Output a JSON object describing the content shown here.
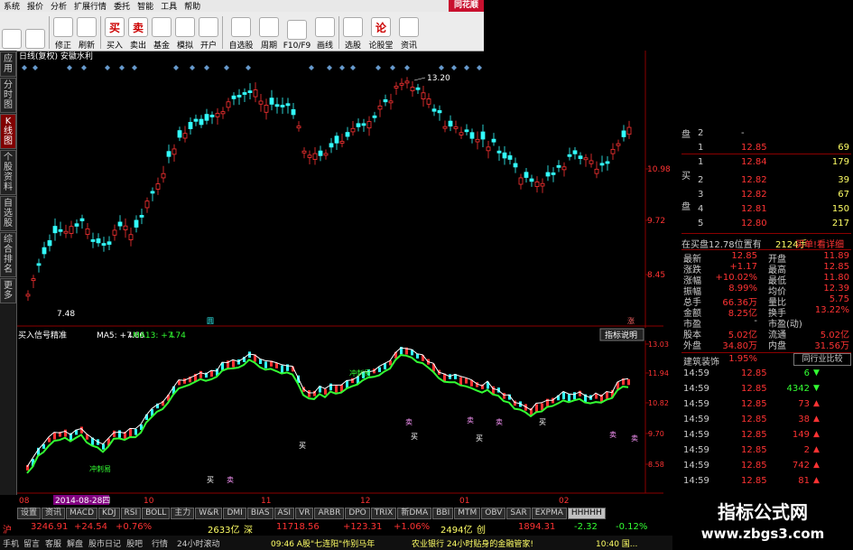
{
  "menu": [
    "系统",
    "报价",
    "分析",
    "扩展行情",
    "委托",
    "智能",
    "工具",
    "帮助"
  ],
  "brand": "同花顺",
  "toolbar": [
    {
      "label": "",
      "icon": "grid-icon"
    },
    {
      "label": "",
      "icon": "back-arrow-icon"
    },
    {
      "label": "修正",
      "icon": "fix-icon"
    },
    {
      "label": "刷新",
      "icon": "clock-icon"
    },
    {
      "label": "买入",
      "icon": "buy-icon",
      "glyph": "买"
    },
    {
      "label": "卖出",
      "icon": "sell-icon",
      "glyph": "卖"
    },
    {
      "label": "基金",
      "icon": "fund-icon"
    },
    {
      "label": "模拟",
      "icon": "hammer-icon"
    },
    {
      "label": "开户",
      "icon": "account-icon"
    },
    {
      "label": "自选股",
      "icon": "watchlist-icon"
    },
    {
      "label": "周期",
      "icon": "period-icon"
    },
    {
      "label": "F10/F9",
      "icon": "f10-icon"
    },
    {
      "label": "画线",
      "icon": "pen-icon"
    },
    {
      "label": "选股",
      "icon": "select-icon"
    },
    {
      "label": "论股堂",
      "icon": "forum-icon",
      "glyph": "论"
    },
    {
      "label": "资讯",
      "icon": "news-icon"
    }
  ],
  "left_tabs": [
    {
      "label": "应用"
    },
    {
      "label": "分时图"
    },
    {
      "label": "K线图",
      "active": true
    },
    {
      "label": "个股资料"
    },
    {
      "label": "自选股"
    },
    {
      "label": "综合排名"
    },
    {
      "label": "更多"
    }
  ],
  "chart_header": "日线(复权) 安徽水利",
  "price_labels": [
    "10.98",
    "9.72",
    "8.45"
  ],
  "annot_high": "13.20",
  "annot_low": "7.48",
  "indicator_bar": {
    "name": "买入信号精准",
    "ma5": "MA5: +7.66",
    "ma13": "MA13: +7.74",
    "button": "指标说明"
  },
  "ind_labels": [
    "13.03",
    "11.94",
    "10.82",
    "9.70",
    "8.58"
  ],
  "ind_signals": [
    "冲刺易",
    "冲刺易",
    "买",
    "卖",
    "买",
    "卖",
    "买",
    "卖",
    "买",
    "卖",
    "买",
    "卖",
    "卖"
  ],
  "date_axis": [
    "08",
    "2014-08-28四",
    "10",
    "11",
    "12",
    "01",
    "02"
  ],
  "right_panel": {
    "ask_label": "盘",
    "bid_label1": "买",
    "bid_label2": "盘",
    "book": [
      {
        "n": "2",
        "p": "-",
        "v": ""
      },
      {
        "n": "1",
        "p": "12.85",
        "v": "69"
      },
      {
        "n": "1",
        "p": "12.84",
        "v": "179"
      },
      {
        "n": "2",
        "p": "12.82",
        "v": "39"
      },
      {
        "n": "3",
        "p": "12.82",
        "v": "67"
      },
      {
        "n": "4",
        "p": "12.81",
        "v": "150"
      },
      {
        "n": "5",
        "p": "12.80",
        "v": "217"
      }
    ],
    "order_line": "在买盘12.78位置有",
    "order_vol": "2124手",
    "order_tail": "买单!看详细",
    "stats": [
      [
        "最新",
        "12.85",
        "开盘",
        "11.89"
      ],
      [
        "涨跌",
        "+1.17",
        "最高",
        "12.85"
      ],
      [
        "涨幅",
        "+10.02%",
        "最低",
        "11.80"
      ],
      [
        "振幅",
        "8.99%",
        "均价",
        "12.39"
      ],
      [
        "总手",
        "66.36万",
        "量比",
        "5.75"
      ],
      [
        "金额",
        "8.25亿",
        "换手",
        "13.22%"
      ],
      [
        "市盈",
        "-",
        "市盈(动)",
        ""
      ],
      [
        "股本",
        "5.02亿",
        "流通",
        "5.02亿"
      ],
      [
        "外盘",
        "34.80万",
        "内盘",
        "31.56万"
      ]
    ],
    "sector": "建筑装饰",
    "sector_pct": "1.95%",
    "sector_btn": "同行业比较",
    "ticks": [
      [
        "14:59",
        "12.85",
        "6",
        "down"
      ],
      [
        "14:59",
        "12.85",
        "4342",
        "down"
      ],
      [
        "14:59",
        "12.85",
        "73",
        "up"
      ],
      [
        "14:59",
        "12.85",
        "38",
        "up"
      ],
      [
        "14:59",
        "12.85",
        "149",
        "up"
      ],
      [
        "14:59",
        "12.85",
        "2",
        "up"
      ],
      [
        "14:59",
        "12.85",
        "742",
        "up"
      ],
      [
        "14:59",
        "12.85",
        "81",
        "up"
      ]
    ]
  },
  "bottom_tabs": [
    "设置",
    "资讯",
    "MACD",
    "KDJ",
    "RSI",
    "BOLL",
    "主力",
    "W&R",
    "DMI",
    "BIAS",
    "ASI",
    "VR",
    "ARBR",
    "DPO",
    "TRIX",
    "新DMA",
    "BBI",
    "MTM",
    "OBV",
    "SAR",
    "EXPMA",
    "HHHHH"
  ],
  "index_bar": [
    {
      "t": "沪",
      "c": "#ff3333"
    },
    {
      "t": "3246.91",
      "c": "#ff3333"
    },
    {
      "t": "+24.54",
      "c": "#ff3333"
    },
    {
      "t": "+0.76%",
      "c": "#ff3333"
    },
    {
      "t": "2633亿",
      "c": "#ffff66"
    },
    {
      "t": "深",
      "c": "#ffff66"
    },
    {
      "t": "11718.56",
      "c": "#ff3333"
    },
    {
      "t": "+123.31",
      "c": "#ff3333"
    },
    {
      "t": "+1.06%",
      "c": "#ff3333"
    },
    {
      "t": "2494亿",
      "c": "#ffff66"
    },
    {
      "t": "创",
      "c": "#ffff66"
    },
    {
      "t": "1894.31",
      "c": "#ff3333"
    },
    {
      "t": "-2.32",
      "c": "#33ff33"
    },
    {
      "t": "-0.12%",
      "c": "#33ff33"
    }
  ],
  "status_bar": [
    "手机",
    "留言",
    "客服",
    "解盘",
    "股市日记",
    "股吧",
    "行情",
    "24小时滚动",
    "09:46 A股\"七连阳\"作别马年",
    "农业银行 24小时贴身的金融管家!",
    "10:40 国..."
  ],
  "watermark": {
    "title": "指标公式网",
    "url": "www.zbgs3.com"
  },
  "colors": {
    "up": "#ff3333",
    "down": "#33ffff",
    "ma5": "#ffffff",
    "ma13": "#33ff33",
    "grid": "#8b0000"
  }
}
